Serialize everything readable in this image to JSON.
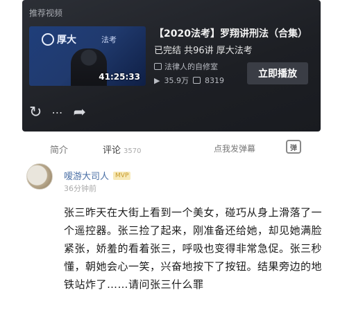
{
  "video_card": {
    "section_label": "推荐视频",
    "thumbnail": {
      "logo_text": "厚大",
      "logo_text_secondary": "法考",
      "duration": "41:25:33"
    },
    "title": "【2020法考】罗翔讲刑法（合集）",
    "subtitle": "已完结 共96讲 厚大法考",
    "channel": "法律人的自修室",
    "views": "35.9万",
    "comments_count": "8319",
    "play_button": "立即播放"
  },
  "tabs": {
    "intro": "简介",
    "comments": "评论",
    "comments_count": "3570",
    "danmaku_prompt": "点我发弹幕",
    "danmaku_icon": "弹"
  },
  "comment": {
    "username": "嗳游大司人",
    "badge": "MVP",
    "time": "36分钟前",
    "text": "张三昨天在大街上看到一个美女，碰巧从身上滑落了一个遥控器。张三捡了起来，刚准备还给她，却见她满脸紧张，娇羞的看着张三，呼吸也变得非常急促。张三秒懂，朝她会心一笑，兴奋地按下了按钮。结果旁边的地铁站炸了……请问张三什么罪"
  },
  "icons": [
    "refresh-icon",
    "more-icon",
    "share-icon",
    "views-icon",
    "comments-icon",
    "channel-icon",
    "danmaku-icon"
  ]
}
